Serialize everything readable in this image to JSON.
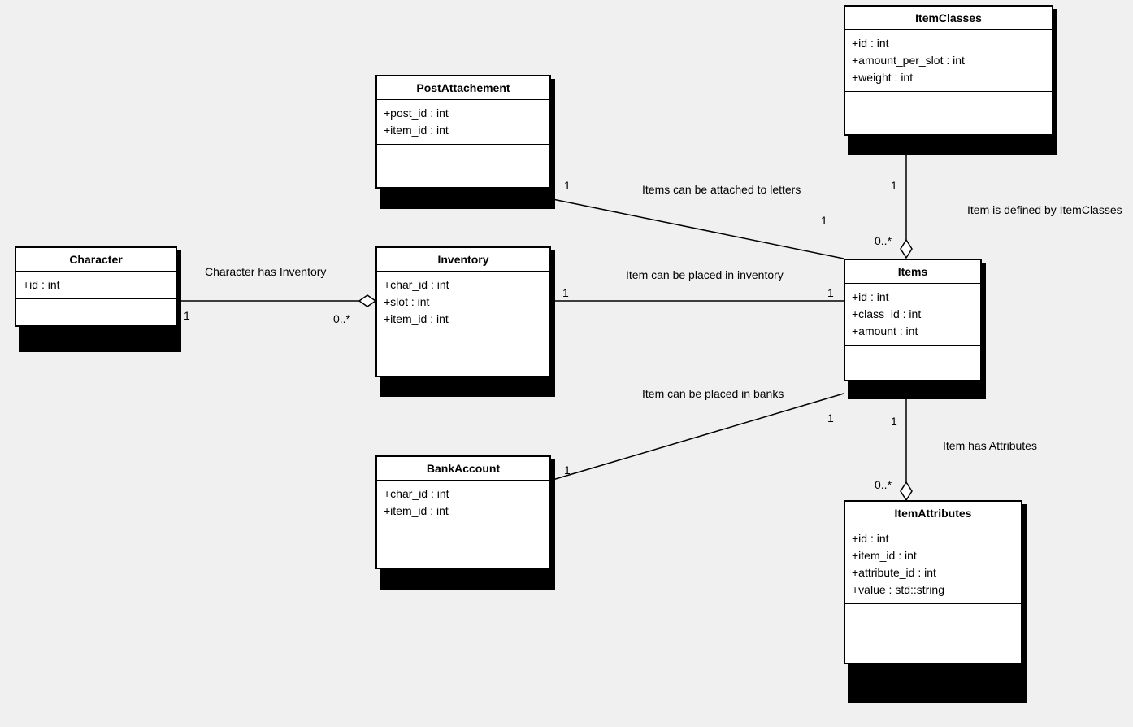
{
  "classes": {
    "character": {
      "name": "Character",
      "attrs": [
        "+id : int"
      ]
    },
    "postAttachement": {
      "name": "PostAttachement",
      "attrs": [
        "+post_id : int",
        "+item_id : int"
      ]
    },
    "inventory": {
      "name": "Inventory",
      "attrs": [
        "+char_id : int",
        "+slot : int",
        "+item_id : int"
      ]
    },
    "bankAccount": {
      "name": "BankAccount",
      "attrs": [
        "+char_id : int",
        "+item_id : int"
      ]
    },
    "itemClasses": {
      "name": "ItemClasses",
      "attrs": [
        "+id : int",
        "+amount_per_slot : int",
        "+weight : int"
      ]
    },
    "items": {
      "name": "Items",
      "attrs": [
        "+id : int",
        "+class_id : int",
        "+amount : int"
      ]
    },
    "itemAttributes": {
      "name": "ItemAttributes",
      "attrs": [
        "+id : int",
        "+item_id : int",
        "+attribute_id : int",
        "+value : std::string"
      ]
    }
  },
  "relations": {
    "charInventory": {
      "label": "Character has Inventory",
      "m1": "1",
      "m2": "0..*"
    },
    "itemsAttached": {
      "label": "Items can be attached to letters",
      "m1": "1",
      "m2": "1"
    },
    "itemInventory": {
      "label": "Item can be placed in inventory",
      "m1": "1",
      "m2": "1"
    },
    "itemBanks": {
      "label": "Item can be placed in banks",
      "m1": "1",
      "m2": "1"
    },
    "itemDefined": {
      "label": "Item is defined by ItemClasses",
      "m1": "1",
      "m2": "0..*"
    },
    "itemAttrs": {
      "label": "Item has Attributes",
      "m1": "1",
      "m2": "0..*"
    }
  }
}
